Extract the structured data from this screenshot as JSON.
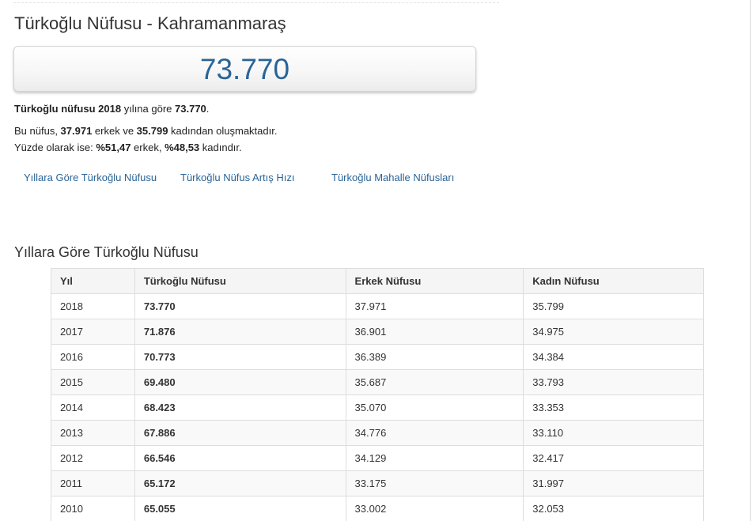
{
  "title": "Türkoğlu Nüfusu - Kahramanmaraş",
  "population_box": {
    "value": "73.770"
  },
  "summary": {
    "lead_bold": "Türkoğlu nüfusu 2018",
    "lead_mid": " yılına göre ",
    "lead_value": "73.770",
    "lead_end": ".",
    "l2_a": "Bu nüfus, ",
    "male_count": "37.971",
    "l2_b": " erkek ve ",
    "female_count": "35.799",
    "l2_c": " kadından oluşmaktadır.",
    "l3_a": "Yüzde olarak ise: ",
    "male_pct": "%51,47",
    "l3_b": " erkek, ",
    "female_pct": "%48,53",
    "l3_c": " kadındır."
  },
  "nav_links": [
    {
      "label": "Yıllara Göre Türkoğlu Nüfusu"
    },
    {
      "label": "Türkoğlu Nüfus Artış Hızı"
    },
    {
      "label": "Türkoğlu Mahalle Nüfusları"
    }
  ],
  "section_title": "Yıllara Göre Türkoğlu Nüfusu",
  "table": {
    "headers": [
      "Yıl",
      "Türkoğlu Nüfusu",
      "Erkek Nüfusu",
      "Kadın Nüfusu"
    ],
    "rows": [
      [
        "2018",
        "73.770",
        "37.971",
        "35.799"
      ],
      [
        "2017",
        "71.876",
        "36.901",
        "34.975"
      ],
      [
        "2016",
        "70.773",
        "36.389",
        "34.384"
      ],
      [
        "2015",
        "69.480",
        "35.687",
        "33.793"
      ],
      [
        "2014",
        "68.423",
        "35.070",
        "33.353"
      ],
      [
        "2013",
        "67.886",
        "34.776",
        "33.110"
      ],
      [
        "2012",
        "66.546",
        "34.129",
        "32.417"
      ],
      [
        "2011",
        "65.172",
        "33.175",
        "31.997"
      ],
      [
        "2010",
        "65.055",
        "33.002",
        "32.053"
      ]
    ]
  },
  "colors": {
    "link": "#2a6497",
    "value": "#2a6497",
    "header_bg": "#f5f5f5",
    "border": "#dddddd"
  }
}
